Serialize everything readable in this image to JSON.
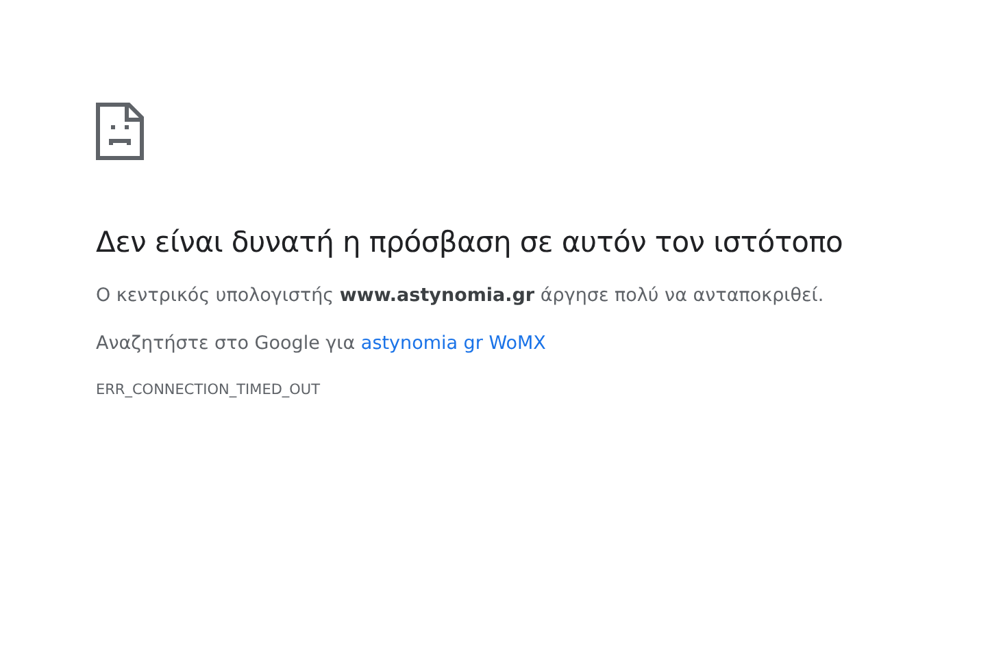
{
  "heading": "Δεν είναι δυνατή η πρόσβαση σε αυτόν τον ιστότοπο",
  "message": "Ο κεντρικός υπολογιστής **www.astynomia.gr** άργησε πολύ να ανταποκριθεί.",
  "suggestion": {
    "text": "Αναζητήστε στο Google για",
    "link": "astynomia gr WoMX"
  },
  "error_code": "ERR_CONNECTION_TIMED_OUT"
}
